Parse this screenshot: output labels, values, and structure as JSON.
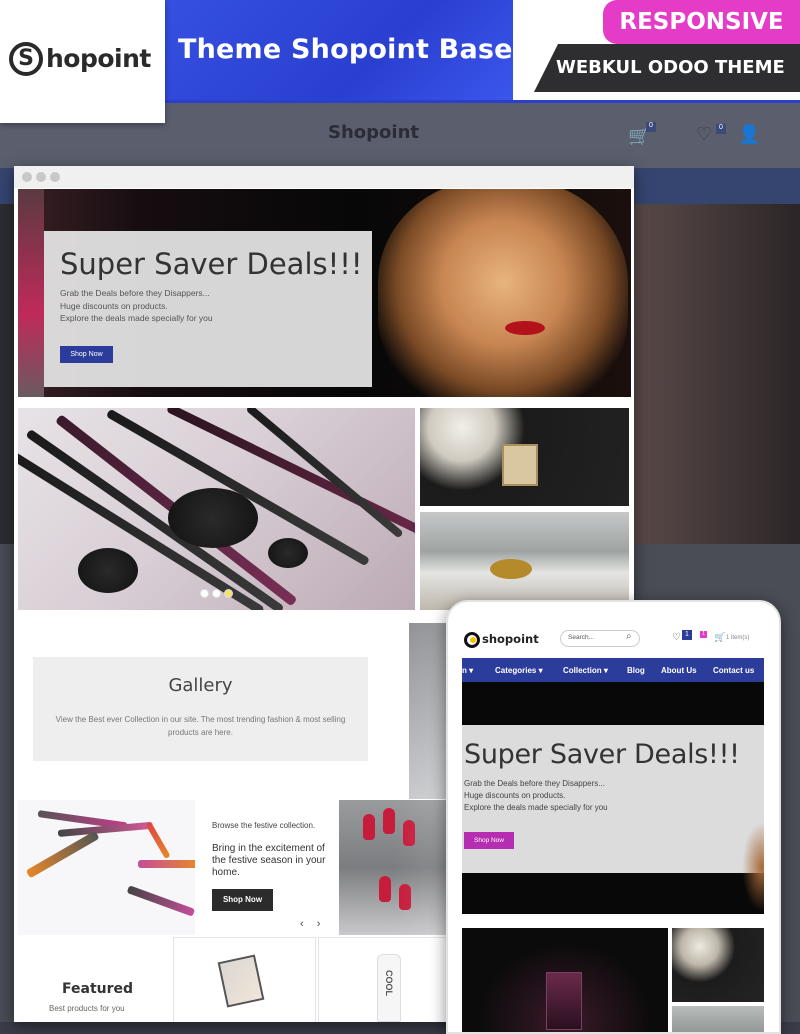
{
  "brand": {
    "logo_mark": "S",
    "logo_text": "hopoint",
    "title": "Theme Shopoint Base",
    "badge": "RESPONSIVE",
    "tagline": "WEBKUL ODOO THEME"
  },
  "background": {
    "logo_text": "Shopoint",
    "cart_count": "0",
    "wishlist_count": "0"
  },
  "desktop": {
    "hero": {
      "heading": "Super Saver Deals!!!",
      "lines": [
        "Grab the Deals before they Disappers...",
        "Huge discounts on products.",
        "Explore the deals made specially for you"
      ],
      "button": "Shop Now"
    },
    "gallery": {
      "heading": "Gallery",
      "text": "View the Best ever Collection in our site. The most trending fashion & most selling products are here."
    },
    "festive": {
      "small": "Browse the festive collection.",
      "big": "Bring in the excitement of the festive season in your home.",
      "button": "Shop Now",
      "prev": "‹",
      "next": "›"
    },
    "featured": {
      "heading": "Featured",
      "text": "Best products for you",
      "bottle_label": "COOL"
    }
  },
  "mobile": {
    "logo_text": "shopoint",
    "search_placeholder": "Search...",
    "wishlist_count": "1",
    "cart_count": "1",
    "cart_text": "1 item(s)",
    "nav": [
      "n ▾",
      "Categories ▾",
      "Collection ▾",
      "Blog",
      "About Us",
      "Contact us"
    ],
    "hero": {
      "heading": "Super Saver Deals!!!",
      "lines": [
        "Grab the Deals before they Disappers...",
        "Huge discounts on products.",
        "Explore the deals made specially for you"
      ],
      "button": "Shop Now"
    }
  },
  "colors": {
    "accent_blue": "#2c3c9a",
    "badge_pink": "#e53cc7",
    "mobile_button": "#b52db0"
  }
}
